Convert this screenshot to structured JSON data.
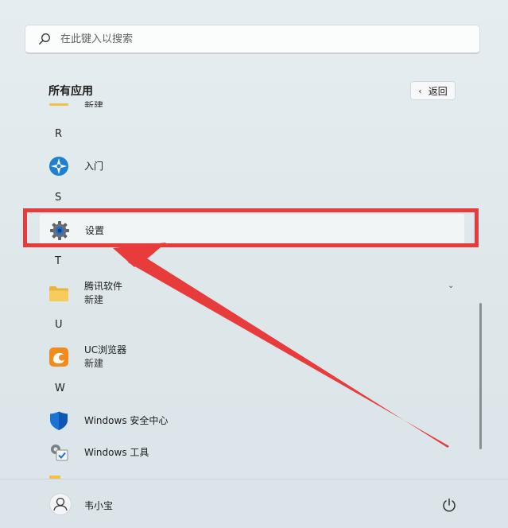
{
  "search": {
    "placeholder": "在此键入以搜索"
  },
  "section": {
    "title": "所有应用",
    "back_label": "返回"
  },
  "partial_item": {
    "label": "新建"
  },
  "groups": {
    "r": {
      "letter": "R",
      "apps": [
        {
          "name": "入门"
        }
      ]
    },
    "s": {
      "letter": "S",
      "apps": [
        {
          "name": "设置"
        }
      ]
    },
    "t": {
      "letter": "T",
      "apps": [
        {
          "name": "腾讯软件",
          "sub": "新建"
        }
      ]
    },
    "u": {
      "letter": "U",
      "apps": [
        {
          "name": "UC浏览器",
          "sub": "新建"
        }
      ]
    },
    "w": {
      "letter": "W",
      "apps": [
        {
          "name": "Windows 安全中心"
        },
        {
          "name": "Windows 工具"
        }
      ]
    }
  },
  "footer": {
    "user_name": "韦小宝"
  },
  "colors": {
    "highlight": "#e83b3b",
    "folder": "#f1c14c",
    "uc_orange": "#f28b1e",
    "defender_blue": "#1a73d6"
  },
  "icons": {
    "search": "search-icon",
    "back": "chevron-left-icon",
    "get_started": "get-started-icon",
    "settings": "gear-icon",
    "folder": "folder-icon",
    "uc": "uc-browser-icon",
    "defender": "shield-icon",
    "tools": "windows-tools-icon",
    "user": "user-avatar-icon",
    "power": "power-icon"
  }
}
